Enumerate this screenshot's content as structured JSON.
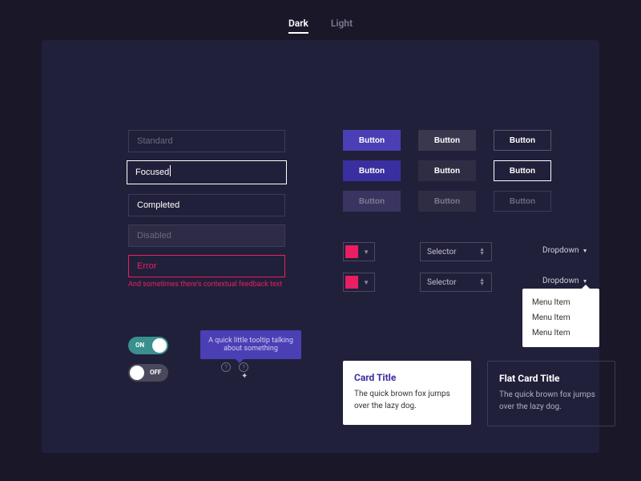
{
  "tabs": {
    "dark": "Dark",
    "light": "Light"
  },
  "inputs": {
    "standard_ph": "Standard",
    "focused_val": "Focused",
    "completed_val": "Completed",
    "disabled_ph": "Disabled",
    "error_val": "Error",
    "error_feedback": "And sometimes there's contextual feedback text"
  },
  "button_label": "Button",
  "colorpicker": {
    "swatch": "#e91e63"
  },
  "selector_label": "Selector",
  "dropdown_label": "Dropdown",
  "menu": {
    "item": "Menu Item"
  },
  "toggle": {
    "on": "ON",
    "off": "OFF"
  },
  "tooltip": "A quick little tooltip talking about something",
  "card": {
    "title": "Card Title",
    "flat_title": "Flat Card Title",
    "body": "The quick brown fox jumps over the lazy dog."
  }
}
